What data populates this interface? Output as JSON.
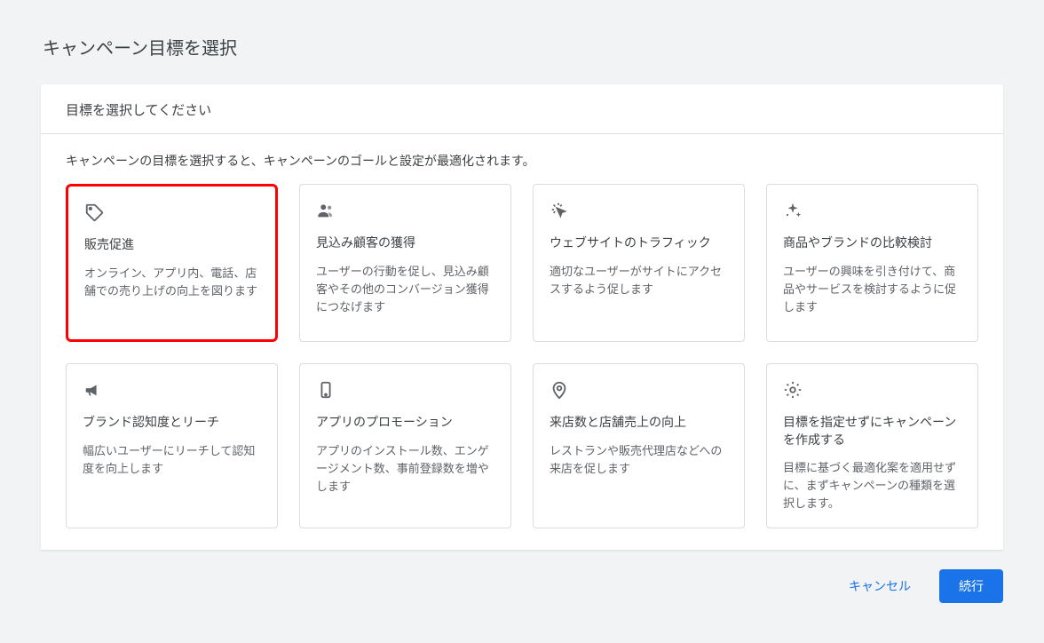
{
  "page_title": "キャンペーン目標を選択",
  "section_title": "目標を選択してください",
  "section_subtitle": "キャンペーンの目標を選択すると、キャンペーンのゴールと設定が最適化されます。",
  "goals": [
    {
      "title": "販売促進",
      "desc": "オンライン、アプリ内、電話、店舗での売り上げの向上を図ります"
    },
    {
      "title": "見込み顧客の獲得",
      "desc": "ユーザーの行動を促し、見込み顧客やその他のコンバージョン獲得につなげます"
    },
    {
      "title": "ウェブサイトのトラフィック",
      "desc": "適切なユーザーがサイトにアクセスするよう促します"
    },
    {
      "title": "商品やブランドの比較検討",
      "desc": "ユーザーの興味を引き付けて、商品やサービスを検討するように促します"
    },
    {
      "title": "ブランド認知度とリーチ",
      "desc": "幅広いユーザーにリーチして認知度を向上します"
    },
    {
      "title": "アプリのプロモーション",
      "desc": "アプリのインストール数、エンゲージメント数、事前登録数を増やします"
    },
    {
      "title": "来店数と店舗売上の向上",
      "desc": "レストランや販売代理店などへの来店を促します"
    },
    {
      "title": "目標を指定せずにキャンペーンを作成する",
      "desc": "目標に基づく最適化案を適用せずに、まずキャンペーンの種類を選択します。"
    }
  ],
  "actions": {
    "cancel": "キャンセル",
    "continue": "続行"
  }
}
